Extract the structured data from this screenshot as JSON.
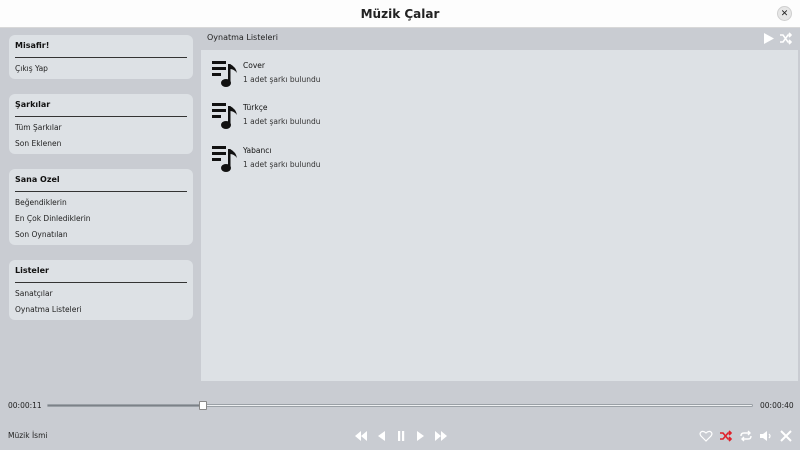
{
  "window": {
    "title": "Müzik Çalar",
    "close_glyph": "✕"
  },
  "sidebar": {
    "sections": [
      {
        "header": "Misafir!",
        "items": [
          "Çıkış Yap"
        ]
      },
      {
        "header": "Şarkılar",
        "items": [
          "Tüm Şarkılar",
          "Son Eklenen"
        ]
      },
      {
        "header": "Sana Ozel",
        "items": [
          "Beğendiklerin",
          "En Çok Dinlediklerin",
          "Son Oynatılan"
        ]
      },
      {
        "header": "Listeler",
        "items": [
          "Sanatçılar",
          "Oynatma Listeleri"
        ]
      }
    ]
  },
  "main": {
    "title": "Oynatma Listeleri",
    "actions": [
      "play-icon",
      "shuffle-icon"
    ],
    "playlists": [
      {
        "name": "Cover",
        "count": "1 adet şarkı bulundu"
      },
      {
        "name": "Türkçe",
        "count": "1 adet şarkı bulundu"
      },
      {
        "name": "Yabancı",
        "count": "1 adet şarkı bulundu"
      }
    ]
  },
  "player": {
    "current_time": "00:00:11",
    "total_time": "00:00:40",
    "progress_fraction": 0.22,
    "song_name": "Müzik İsmi",
    "transport_icons": [
      "fast-rewind-icon",
      "previous-icon",
      "pause-icon",
      "next-icon",
      "fast-forward-icon"
    ],
    "right_icons": [
      "heart-icon",
      "shuffle-icon",
      "repeat-icon",
      "volume-icon",
      "close-icon"
    ],
    "colors": {
      "accent": "#e0202a",
      "icon": "#ffffff",
      "icon_dim": "#e6e6e6"
    }
  }
}
